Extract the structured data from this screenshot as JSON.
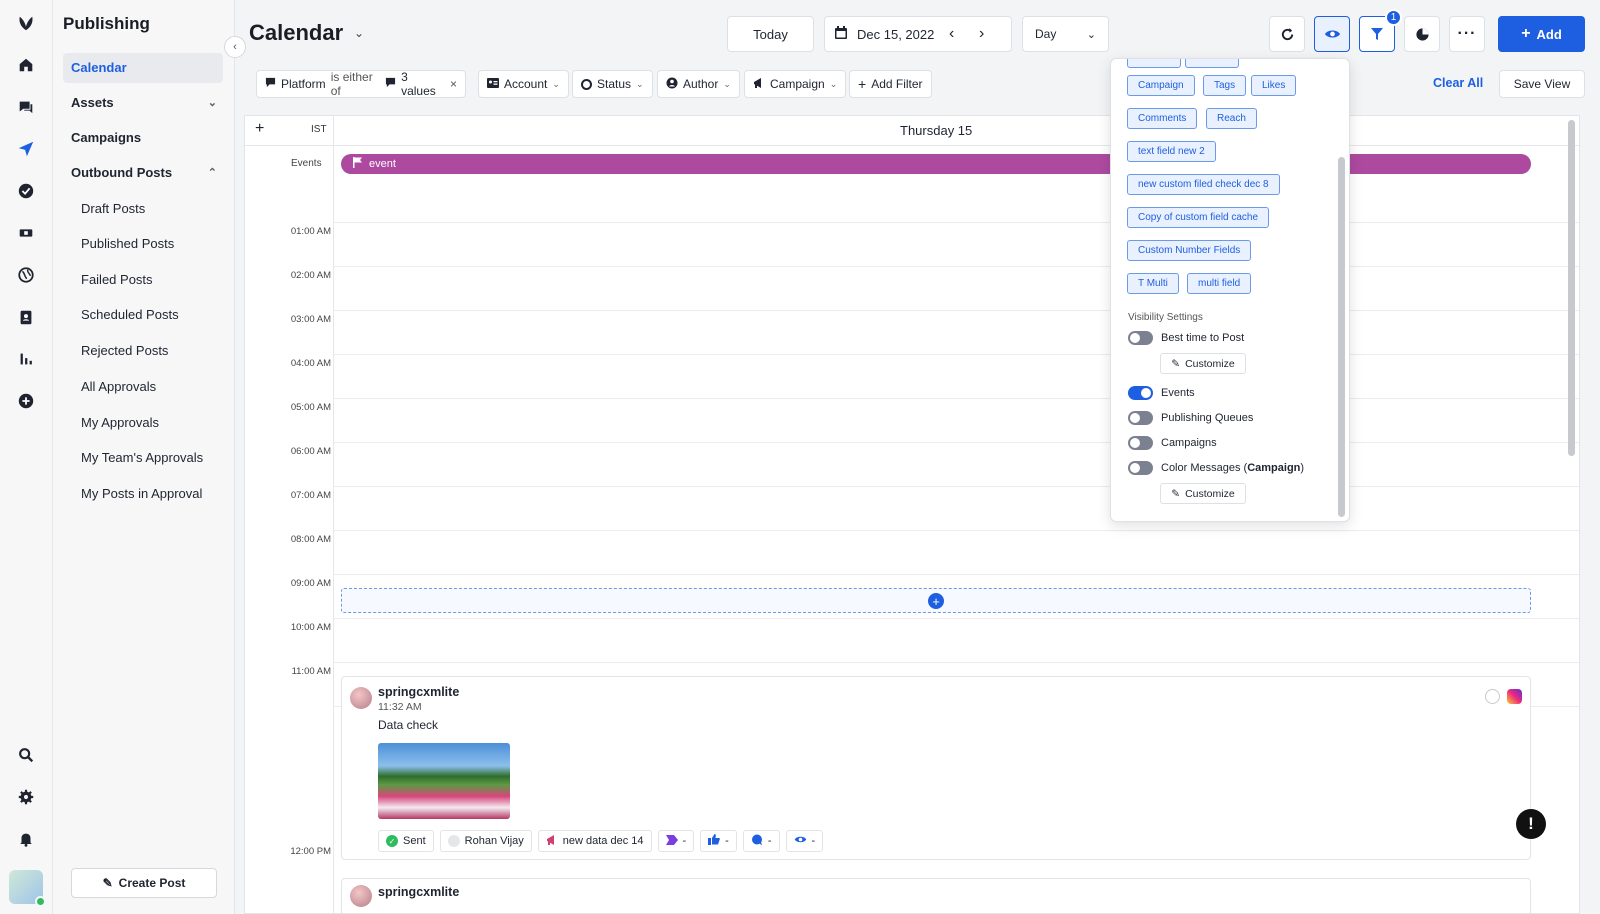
{
  "app": {
    "section_title": "Publishing",
    "page_title": "Calendar"
  },
  "nav": {
    "items": [
      {
        "label": "Calendar"
      },
      {
        "label": "Assets"
      },
      {
        "label": "Campaigns"
      },
      {
        "label": "Outbound Posts"
      },
      {
        "label": "Draft Posts"
      },
      {
        "label": "Published Posts"
      },
      {
        "label": "Failed Posts"
      },
      {
        "label": "Scheduled Posts"
      },
      {
        "label": "Rejected Posts"
      },
      {
        "label": "All Approvals"
      },
      {
        "label": "My Approvals"
      },
      {
        "label": "My Team's Approvals"
      },
      {
        "label": "My Posts in Approval"
      }
    ],
    "create_post_label": "Create Post"
  },
  "toolbar": {
    "today_label": "Today",
    "date_label": "Dec 15, 2022",
    "view_label": "Day",
    "filter_badge": "1",
    "add_label": "Add"
  },
  "filters": {
    "platform_label": "Platform",
    "platform_op": "is either of",
    "platform_values": "3 values",
    "account_label": "Account",
    "status_label": "Status",
    "author_label": "Author",
    "campaign_label": "Campaign",
    "add_filter_label": "Add Filter",
    "clear_all_label": "Clear All",
    "save_view_label": "Save View"
  },
  "calendar": {
    "timezone": "IST",
    "day_header": "Thursday 15",
    "events_label": "Events",
    "event_title": "event",
    "hours": [
      "01:00 AM",
      "02:00 AM",
      "03:00 AM",
      "04:00 AM",
      "05:00 AM",
      "06:00 AM",
      "07:00 AM",
      "08:00 AM",
      "09:00 AM",
      "10:00 AM",
      "11:00 AM",
      "12:00 PM"
    ]
  },
  "post": {
    "author": "springcxmlite",
    "time": "11:32 AM",
    "text": "Data check",
    "status": "Sent",
    "owner": "Rohan Vijay",
    "campaign": "new data dec 14",
    "metric_values": [
      "-",
      "-",
      "-",
      "-"
    ]
  },
  "post2": {
    "author": "springcxmlite"
  },
  "panel": {
    "tags": [
      "Campaign",
      "Tags",
      "Likes",
      "Comments",
      "Reach",
      "text field new 2",
      "new custom filed check dec 8",
      "Copy of custom field cache",
      "Custom Number Fields",
      "T Multi",
      "multi field"
    ],
    "visibility_title": "Visibility Settings",
    "toggles": [
      {
        "label": "Best time to Post",
        "on": false
      },
      {
        "label": "Events",
        "on": true
      },
      {
        "label": "Publishing Queues",
        "on": false
      },
      {
        "label": "Campaigns",
        "on": false
      },
      {
        "label": "Color Messages",
        "on": false
      }
    ],
    "color_messages_suffix": "Campaign",
    "customize_label": "Customize"
  },
  "colors": {
    "accent": "#1d5fe0",
    "event": "#ad4aa0",
    "sent": "#2dbd60"
  }
}
